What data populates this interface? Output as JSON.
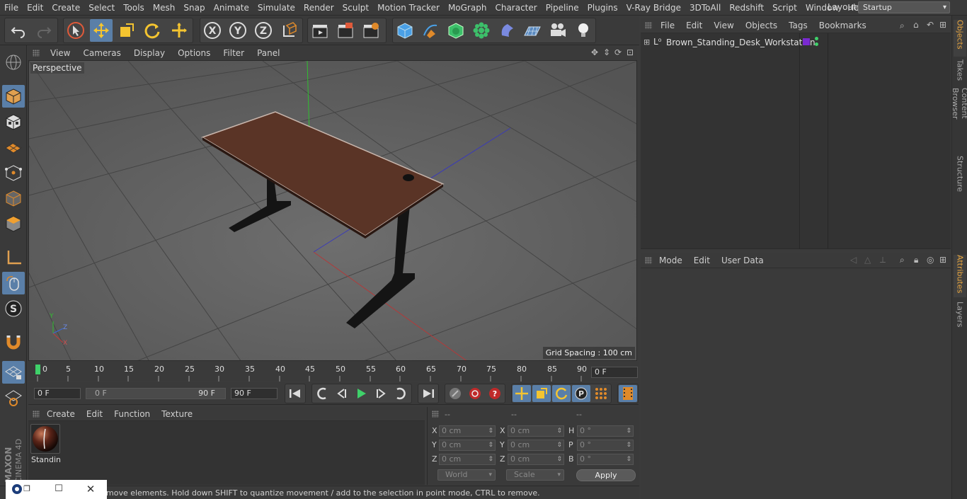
{
  "menubar": {
    "items": [
      "File",
      "Edit",
      "Create",
      "Select",
      "Tools",
      "Mesh",
      "Snap",
      "Animate",
      "Simulate",
      "Render",
      "Sculpt",
      "Motion Tracker",
      "MoGraph",
      "Character",
      "Pipeline",
      "Plugins",
      "V-Ray Bridge",
      "3DToAll",
      "Redshift",
      "Script",
      "Window",
      "Help"
    ],
    "layout_label": "Layout:",
    "layout_value": "Startup"
  },
  "viewport": {
    "menu": [
      "View",
      "Cameras",
      "Display",
      "Options",
      "Filter",
      "Panel"
    ],
    "label": "Perspective",
    "grid_spacing": "Grid Spacing : 100 cm",
    "axis_labels": {
      "y": "Y",
      "z": "Z",
      "x": "X"
    }
  },
  "timeline": {
    "ticks": [
      "0",
      "5",
      "10",
      "15",
      "20",
      "25",
      "30",
      "35",
      "40",
      "45",
      "50",
      "55",
      "60",
      "65",
      "70",
      "75",
      "80",
      "85",
      "90"
    ],
    "current_frame": "0 F",
    "start_field": "0 F",
    "range_start": "0 F",
    "range_end": "90 F",
    "end_field": "90 F"
  },
  "materials": {
    "menu": [
      "Create",
      "Edit",
      "Function",
      "Texture"
    ],
    "items": [
      {
        "name": "Standin"
      }
    ]
  },
  "coordinates": {
    "headers": [
      "--",
      "--",
      "--"
    ],
    "rows": [
      {
        "l1": "X",
        "v1": "0 cm",
        "l2": "X",
        "v2": "0 cm",
        "l3": "H",
        "v3": "0 °"
      },
      {
        "l1": "Y",
        "v1": "0 cm",
        "l2": "Y",
        "v2": "0 cm",
        "l3": "P",
        "v3": "0 °"
      },
      {
        "l1": "Z",
        "v1": "0 cm",
        "l2": "Z",
        "v2": "0 cm",
        "l3": "B",
        "v3": "0 °"
      }
    ],
    "mode_world": "World",
    "mode_scale": "Scale",
    "apply_label": "Apply"
  },
  "status": {
    "text": "move elements. Hold down SHIFT to quantize movement / add to the selection in point mode, CTRL to remove."
  },
  "object_manager": {
    "menu": [
      "File",
      "Edit",
      "View",
      "Objects",
      "Tags",
      "Bookmarks"
    ],
    "objects": [
      {
        "name": "Brown_Standing_Desk_Workstation",
        "tag_color": "#7a2ad1"
      }
    ]
  },
  "attribute_manager": {
    "menu": [
      "Mode",
      "Edit",
      "User Data"
    ]
  },
  "right_tabs": [
    "Objects",
    "Takes",
    "Content Browser",
    "Structure",
    "Attributes",
    "Layers"
  ],
  "branding": {
    "maker": "MAXON",
    "product": "CINEMA 4D"
  },
  "colors": {
    "accent_blue": "#5a7fa8",
    "desk_top": "#5a3426",
    "tab_active": "#e8a640",
    "timeline_marker": "#3fd16a"
  }
}
